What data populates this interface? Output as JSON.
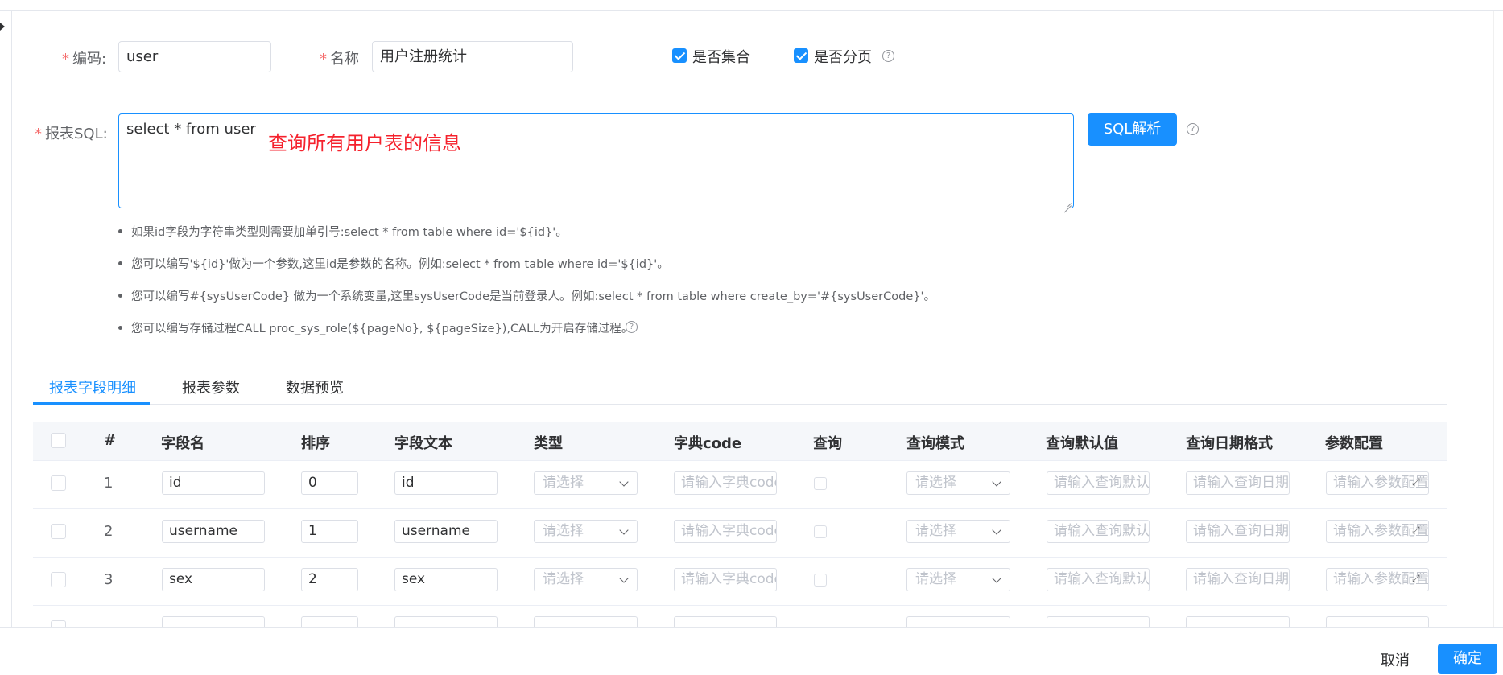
{
  "form": {
    "code_label": "编码:",
    "code_value": "user",
    "name_label": "名称",
    "name_value": "用户注册统计",
    "is_collection_label": "是否集合",
    "is_paged_label": "是否分页",
    "sql_label": "报表SQL:",
    "sql_value": "select * from user",
    "sql_annotation": "查询所有用户表的信息",
    "sql_parse_button": "SQL解析",
    "required_mark": "*",
    "help_glyph": "?"
  },
  "tips": [
    "如果id字段为字符串类型则需要加单引号:select * from table where id='${id}'。",
    "您可以编写'${id}'做为一个参数,这里id是参数的名称。例如:select * from table where id='${id}'。",
    "您可以编写#{sysUserCode} 做为一个系统变量,这里sysUserCode是当前登录人。例如:select * from table where create_by='#{sysUserCode}'。",
    "您可以编写存储过程CALL proc_sys_role(${pageNo}, ${pageSize}),CALL为开启存储过程。"
  ],
  "tabs": [
    {
      "label": "报表字段明细",
      "active": true
    },
    {
      "label": "报表参数",
      "active": false
    },
    {
      "label": "数据预览",
      "active": false
    }
  ],
  "table": {
    "columns": [
      "#",
      "字段名",
      "排序",
      "字段文本",
      "类型",
      "字典code",
      "查询",
      "查询模式",
      "查询默认值",
      "查询日期格式",
      "参数配置"
    ],
    "rows": [
      {
        "num": "1",
        "field": "id",
        "order": "0",
        "text": "id"
      },
      {
        "num": "2",
        "field": "username",
        "order": "1",
        "text": "username"
      },
      {
        "num": "3",
        "field": "sex",
        "order": "2",
        "text": "sex"
      }
    ],
    "placeholders": {
      "type": "请选择",
      "dict": "请输入字典code",
      "mode": "请选择",
      "default": "请输入查询默认值",
      "date_format": "请输入查询日期格式",
      "param": "请输入参数配置"
    }
  },
  "footer": {
    "cancel": "取消",
    "confirm": "确定"
  },
  "colors": {
    "primary": "#1890ff",
    "required": "#f56c6c",
    "annotation": "#f5222d"
  }
}
